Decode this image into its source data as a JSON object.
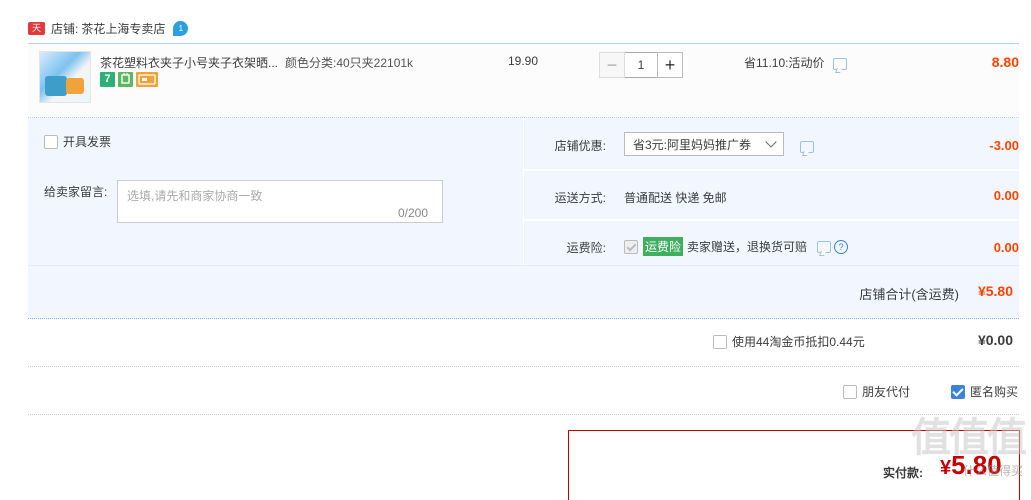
{
  "shop": {
    "tmall_badge": "天猫",
    "label": "店铺:",
    "name": "茶花上海专卖店",
    "ww_icon": "wangwang-icon"
  },
  "item": {
    "title": "茶花塑料衣夹子小号夹子衣架晒...",
    "sku": "颜色分类:40只夹22101k",
    "price": "19.90",
    "qty": "1",
    "minus": "−",
    "plus": "+",
    "promo": "省11.10:活动价",
    "subtotal": "8.80",
    "badges": [
      "7"
    ]
  },
  "options": {
    "invoice_label": "开具发票",
    "message_label": "给卖家留言:",
    "message_placeholder": "选填,请先和商家协商一致",
    "message_count": "0/200",
    "coupon_label": "店铺优惠:",
    "coupon_value": "省3元:阿里妈妈推广券",
    "coupon_amount": "-3.00",
    "shipping_label": "运送方式:",
    "shipping_value": "普通配送 快递 免邮",
    "shipping_amount": "0.00",
    "insurance_label": "运费险:",
    "insurance_tag": "运费险",
    "insurance_text": "卖家赠送，退换货可赔",
    "insurance_amount": "0.00",
    "help_glyph": "?"
  },
  "shop_total": {
    "label": "店铺合计(含运费)",
    "value": "¥5.80"
  },
  "coins": {
    "label": "使用44淘金币抵扣0.44元",
    "value": "¥0.00"
  },
  "pay": {
    "friend_label": "朋友代付",
    "anonymous_label": "匿名购买",
    "anonymous_checked": true
  },
  "final": {
    "label": "实付款:",
    "yen": "¥",
    "value": "5.80"
  },
  "watermark": {
    "big": "值值值",
    "small": "什么值得买"
  },
  "colors": {
    "accent": "#ff4400",
    "final": "#c40000",
    "border": "#b2d1ff"
  }
}
